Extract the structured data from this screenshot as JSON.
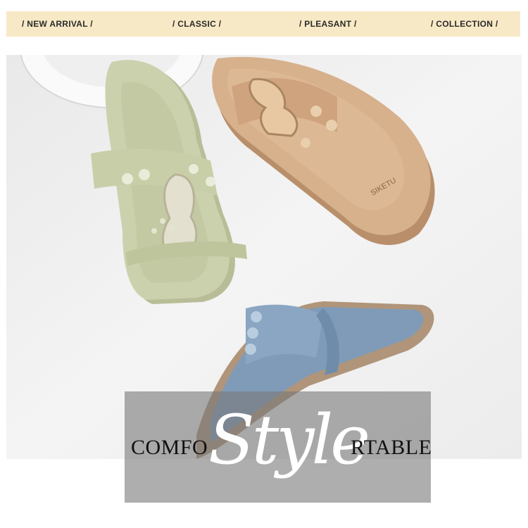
{
  "tags": [
    {
      "label": "/  NEW ARRIVAL  /"
    },
    {
      "label": "/  CLASSIC  /"
    },
    {
      "label": "/  PLEASANT  /"
    },
    {
      "label": "/  COLLECTION  /"
    }
  ],
  "overlay": {
    "left_text": "COMFO",
    "center_text": "Style",
    "right_text": "RTABLE"
  },
  "brand_mark": "SIKETU",
  "colors": {
    "tag_bar": "#f8e9c6",
    "sandal_green": "#c9cfa8",
    "sandal_tan": "#d4ab86",
    "sandal_blue": "#7e9ab6"
  }
}
